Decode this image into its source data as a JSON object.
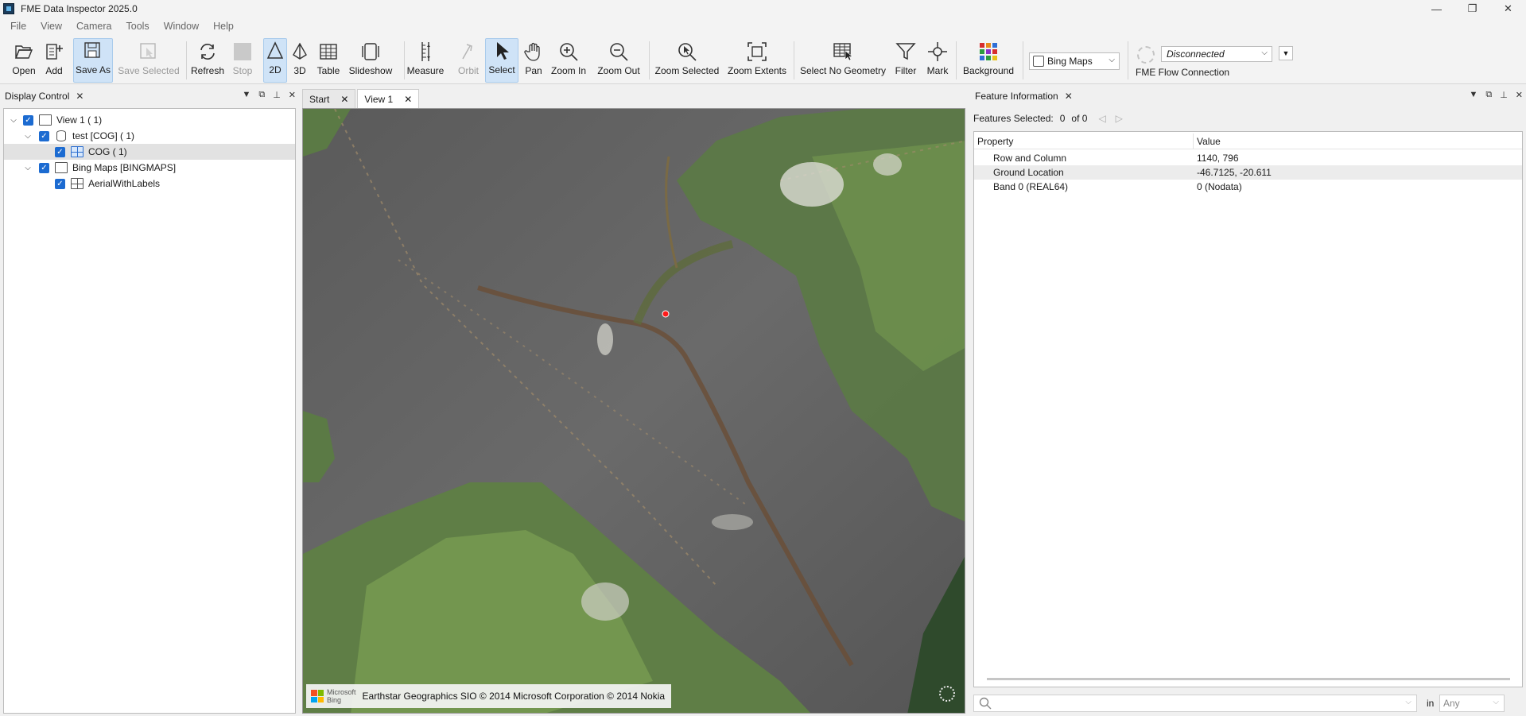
{
  "window": {
    "title": "FME Data Inspector 2025.0",
    "controls": [
      "—",
      "❐",
      "✕"
    ]
  },
  "menu": [
    "File",
    "View",
    "Camera",
    "Tools",
    "Window",
    "Help"
  ],
  "toolbar": {
    "buttons": [
      {
        "id": "open",
        "label": "Open",
        "icon": "folder-open-icon"
      },
      {
        "id": "add",
        "label": "Add",
        "icon": "add-document-icon"
      },
      {
        "id": "save_as",
        "label": "Save As",
        "icon": "save-as-icon"
      },
      {
        "id": "save_selected",
        "label": "Save Selected",
        "icon": "save-selected-icon"
      },
      {
        "id": "refresh",
        "label": "Refresh",
        "icon": "refresh-icon"
      },
      {
        "id": "stop",
        "label": "Stop",
        "icon": "stop-icon"
      },
      {
        "id": "2d",
        "label": "2D",
        "icon": "triangle-2d-icon"
      },
      {
        "id": "3d",
        "label": "3D",
        "icon": "pyramid-3d-icon"
      },
      {
        "id": "table",
        "label": "Table",
        "icon": "table-icon"
      },
      {
        "id": "slideshow",
        "label": "Slideshow",
        "icon": "slideshow-icon"
      },
      {
        "id": "measure",
        "label": "Measure",
        "icon": "measure-icon"
      },
      {
        "id": "orbit",
        "label": "Orbit",
        "icon": "orbit-icon"
      },
      {
        "id": "select",
        "label": "Select",
        "icon": "cursor-arrow-icon"
      },
      {
        "id": "pan",
        "label": "Pan",
        "icon": "hand-icon"
      },
      {
        "id": "zoom_in",
        "label": "Zoom In",
        "icon": "zoom-in-icon"
      },
      {
        "id": "zoom_out",
        "label": "Zoom Out",
        "icon": "zoom-out-icon"
      },
      {
        "id": "zoom_selected",
        "label": "Zoom Selected",
        "icon": "zoom-selected-icon"
      },
      {
        "id": "zoom_extents",
        "label": "Zoom Extents",
        "icon": "zoom-extents-icon"
      },
      {
        "id": "select_no_geometry",
        "label": "Select No Geometry",
        "icon": "table-cursor-icon"
      },
      {
        "id": "filter",
        "label": "Filter",
        "icon": "filter-icon"
      },
      {
        "id": "mark",
        "label": "Mark",
        "icon": "mark-crosshair-icon"
      },
      {
        "id": "background",
        "label": "Background",
        "icon": "color-grid-icon"
      }
    ],
    "basemap": "Bing Maps",
    "connection_status": "Disconnected",
    "connection_label": "FME Flow Connection"
  },
  "display_control": {
    "title": "Display Control",
    "tree": [
      {
        "label": "View 1 ( 1)",
        "level": 0,
        "expanded": true,
        "checked": true,
        "icon": "view-icon"
      },
      {
        "label": "test [COG] ( 1)",
        "level": 1,
        "expanded": true,
        "checked": true,
        "icon": "database-icon"
      },
      {
        "label": "COG ( 1)",
        "level": 2,
        "checked": true,
        "icon": "raster-grid-icon",
        "selected": true
      },
      {
        "label": "Bing Maps [BINGMAPS]",
        "level": 1,
        "expanded": true,
        "checked": true,
        "icon": "bing-maps-icon"
      },
      {
        "label": "AerialWithLabels",
        "level": 2,
        "checked": true,
        "icon": "raster-grid-icon"
      }
    ]
  },
  "view_tabs": [
    {
      "label": "Start",
      "active": false
    },
    {
      "label": "View 1",
      "active": true
    }
  ],
  "map": {
    "credit_brand_1": "Microsoft",
    "credit_brand_2": "Bing",
    "credit_text": "Earthstar Geographics SIO © 2014 Microsoft Corporation © 2014 Nokia"
  },
  "feature_info": {
    "title": "Feature Information",
    "features_selected_label": "Features Selected:",
    "selected_count": "0",
    "of_total": "of 0",
    "columns": [
      "Property",
      "Value"
    ],
    "rows": [
      {
        "property": "Row and Column",
        "value": "1140, 796"
      },
      {
        "property": "Ground Location",
        "value": "-46.7125, -20.611"
      },
      {
        "property": "Band 0 (REAL64)",
        "value": "0 (Nodata)"
      }
    ],
    "search_in_label": "in",
    "search_scope": "Any"
  }
}
